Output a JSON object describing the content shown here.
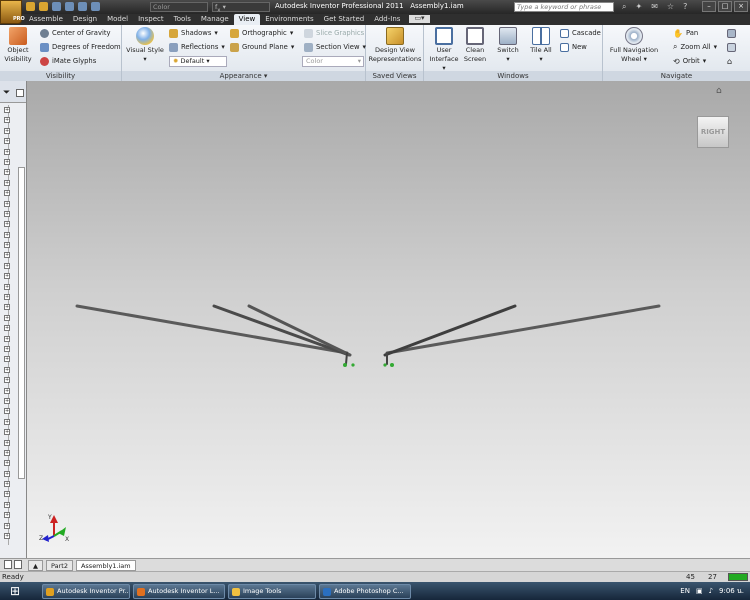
{
  "window": {
    "title": "Autodesk Inventor Professional 2011",
    "document": "Assembly1.iam",
    "app_badge": "PRO"
  },
  "qat": {
    "color_combo": "Color",
    "search_placeholder": "Type a keyword or phrase"
  },
  "tabs": [
    {
      "label": "Assemble"
    },
    {
      "label": "Design"
    },
    {
      "label": "Model"
    },
    {
      "label": "Inspect"
    },
    {
      "label": "Tools"
    },
    {
      "label": "Manage"
    },
    {
      "label": "View",
      "active": true
    },
    {
      "label": "Environments"
    },
    {
      "label": "Get Started"
    },
    {
      "label": "Add-Ins"
    }
  ],
  "ribbon": {
    "visibility": {
      "title": "Visibility",
      "object_visibility": "Object Visibility",
      "center_of_gravity": "Center of Gravity",
      "degrees_of_freedom": "Degrees of Freedom",
      "imate_glyphs": "iMate Glyphs"
    },
    "appearance": {
      "title": "Appearance",
      "visual_style": "Visual Style",
      "shadows": "Shadows",
      "reflections": "Reflections",
      "default": "Default",
      "orthographic": "Orthographic",
      "ground_plane": "Ground Plane",
      "slice_graphics": "Slice Graphics",
      "section_view": "Section View",
      "color": "Color"
    },
    "saved_views": {
      "title": "Saved Views",
      "design_view": "Design View Representations"
    },
    "windows": {
      "title": "Windows",
      "user_interface": "User Interface",
      "clean_screen": "Clean Screen",
      "switch": "Switch",
      "tile_all": "Tile All",
      "cascade": "Cascade",
      "new": "New"
    },
    "navigate": {
      "title": "Navigate",
      "full_nav_wheel": "Full Navigation Wheel",
      "pan": "Pan",
      "zoom_all": "Zoom All",
      "orbit": "Orbit"
    }
  },
  "viewcube": {
    "face": "RIGHT"
  },
  "triad": {
    "x": "X",
    "y": "Y",
    "z": "Z"
  },
  "doc_tabs": [
    {
      "label": "Part2"
    },
    {
      "label": "Assembly1.iam",
      "active": true
    }
  ],
  "status": {
    "text": "Ready",
    "count1": "45",
    "count2": "27"
  },
  "taskbar": {
    "items": [
      {
        "label": "Autodesk Inventor Pr...",
        "color": "#e0a020"
      },
      {
        "label": "Autodesk Inventor L...",
        "color": "#e07020"
      },
      {
        "label": "Image Tools",
        "color": "#f0c040"
      },
      {
        "label": "Adobe Photoshop C...",
        "color": "#2a6fc0"
      }
    ],
    "lang": "EN",
    "clock": "9:06 น."
  }
}
